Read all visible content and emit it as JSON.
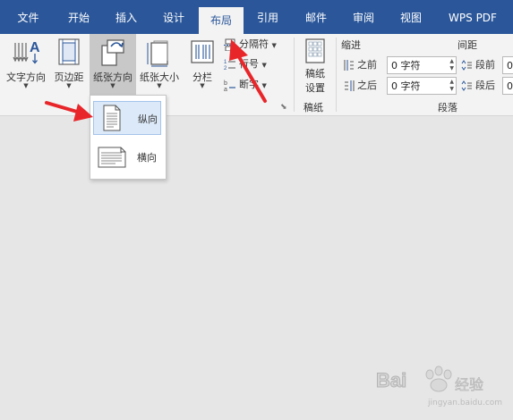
{
  "tabs": [
    "文件",
    "开始",
    "插入",
    "设计",
    "布局",
    "引用",
    "邮件",
    "审阅",
    "视图",
    "WPS PDF"
  ],
  "active_tab": "布局",
  "ribbon": {
    "text_direction": "文字方向",
    "margins": "页边距",
    "orientation": "纸张方向",
    "size": "纸张大小",
    "columns": "分栏",
    "breaks": "分隔符",
    "line_numbers": "行号",
    "hyphenation": "断字",
    "manuscript_line1": "稿纸",
    "manuscript_line2": "设置",
    "manuscript_group": "稿纸",
    "indent_header": "缩进",
    "indent_before_label": "之前",
    "indent_before_value": "0 字符",
    "indent_after_label": "之后",
    "indent_after_value": "0 字符",
    "spacing_header": "间距",
    "spacing_before_label": "段前",
    "spacing_after_label": "段后",
    "spacing_before_value": "0",
    "spacing_after_value": "0",
    "paragraph_group": "段落"
  },
  "orientation_menu": {
    "portrait": "纵向",
    "landscape": "横向"
  },
  "watermark": {
    "brand": "Bai",
    "suffix": "经验",
    "url": "jingyan.baidu.com"
  },
  "colors": {
    "tabbar": "#2b579a",
    "ribbon": "#f3f3f3",
    "document_bg": "#e6e6e6",
    "annotation_arrow": "#e8262a",
    "menu_highlight": "#dce9f8"
  }
}
